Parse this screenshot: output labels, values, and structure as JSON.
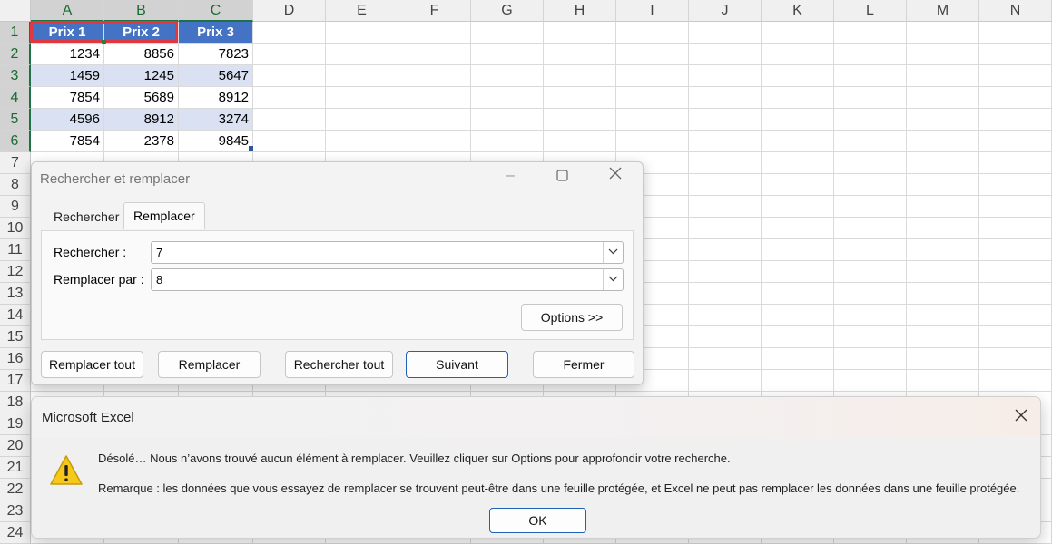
{
  "sheet": {
    "columns": [
      "A",
      "B",
      "C",
      "D",
      "E",
      "F",
      "G",
      "H",
      "I",
      "J",
      "K",
      "L",
      "M",
      "N"
    ],
    "rows": [
      "1",
      "2",
      "3",
      "4",
      "5",
      "6",
      "7",
      "8",
      "9",
      "10",
      "11",
      "12",
      "13",
      "14",
      "15",
      "16",
      "17",
      "18",
      "19",
      "20",
      "21",
      "22",
      "23",
      "24"
    ],
    "headers": [
      "Prix 1",
      "Prix 2",
      "Prix 3"
    ],
    "data": [
      [
        "1234",
        "8856",
        "7823"
      ],
      [
        "1459",
        "1245",
        "5647"
      ],
      [
        "7854",
        "5689",
        "8912"
      ],
      [
        "4596",
        "8912",
        "3274"
      ],
      [
        "7854",
        "2378",
        "9845"
      ]
    ],
    "colors": {
      "header_fill": "#4472c4",
      "band_fill": "#d9e1f2",
      "selection_outline": "#e0383e"
    }
  },
  "find_replace": {
    "title": "Rechercher et remplacer",
    "tabs": [
      "Rechercher",
      "Remplacer"
    ],
    "active_tab": "Remplacer",
    "find_label": "Rechercher :",
    "find_value": "7",
    "replace_label": "Remplacer par :",
    "replace_value": "8",
    "options_button": "Options >>",
    "buttons": {
      "replace_all": "Remplacer tout",
      "replace": "Remplacer",
      "find_all": "Rechercher tout",
      "next": "Suivant",
      "close": "Fermer"
    },
    "icons": [
      "minimize-icon",
      "maximize-icon",
      "close-icon",
      "chevron-down-icon"
    ]
  },
  "message_box": {
    "title": "Microsoft Excel",
    "line1": "Désolé… Nous n’avons trouvé aucun élément à remplacer. Veuillez cliquer sur Options pour approfondir votre recherche.",
    "line2": "Remarque : les données que vous essayez de remplacer se trouvent peut-être dans une feuille protégée, et Excel ne peut pas remplacer les données dans une feuille protégée.",
    "ok": "OK",
    "icons": [
      "warning-icon",
      "close-icon"
    ]
  }
}
